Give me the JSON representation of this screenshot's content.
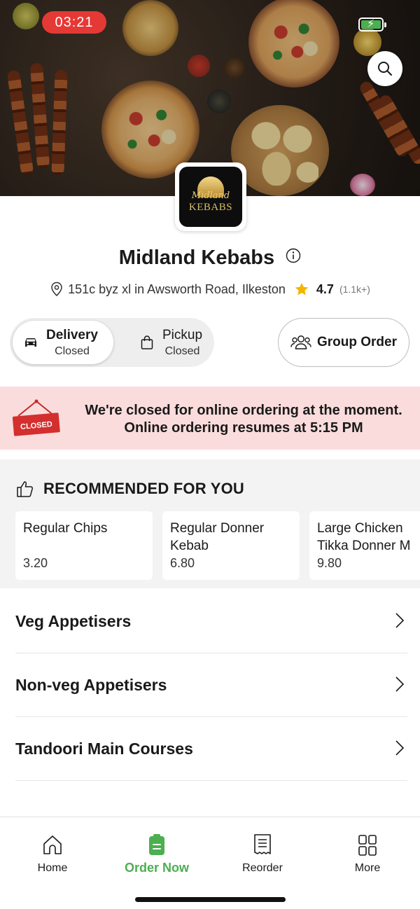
{
  "status_bar": {
    "time": "03:21"
  },
  "restaurant": {
    "name": "Midland Kebabs",
    "address": "151c byz xl in Awsworth Road, Ilkeston",
    "rating": "4.7",
    "rating_count": "(1.1k+)",
    "logo_text_top": "Midland",
    "logo_text_bottom": "KEBABS"
  },
  "service": {
    "delivery": {
      "label": "Delivery",
      "status": "Closed",
      "selected": true
    },
    "pickup": {
      "label": "Pickup",
      "status": "Closed",
      "selected": false
    },
    "group_order_label": "Group Order"
  },
  "closed_banner": {
    "sign_text": "CLOSED",
    "line1": "We're closed for online ordering at the moment.",
    "line2": "Online ordering resumes at 5:15 PM"
  },
  "recommended": {
    "title": "RECOMMENDED FOR YOU",
    "items": [
      {
        "name_line1": "Regular Chips",
        "name_line2": "",
        "price": "3.20"
      },
      {
        "name_line1": "Regular Donner",
        "name_line2": "Kebab",
        "price": "6.80"
      },
      {
        "name_line1": "Large Chicken",
        "name_line2": "Tikka Donner M",
        "price": "9.80"
      }
    ]
  },
  "categories": [
    {
      "label": "Veg Appetisers"
    },
    {
      "label": "Non-veg Appetisers"
    },
    {
      "label": "Tandoori Main Courses"
    }
  ],
  "bottom_nav": {
    "active": "order_now",
    "items": [
      {
        "label": "Home",
        "icon": "home-icon"
      },
      {
        "label": "Order Now",
        "icon": "order-now-icon"
      },
      {
        "label": "Reorder",
        "icon": "receipt-icon"
      },
      {
        "label": "More",
        "icon": "grid-icon"
      }
    ]
  },
  "colors": {
    "accent_green": "#4caf50",
    "status_red": "#e53935",
    "banner_pink": "#fadcdc",
    "star_gold": "#f5b400"
  }
}
